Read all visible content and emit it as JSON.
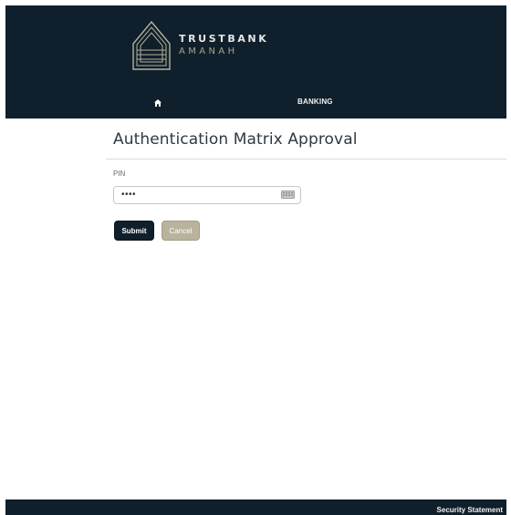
{
  "header": {
    "brand": {
      "line1": "TRUSTBANK",
      "line2": "AMANAH",
      "logo_icon": "pyramid-logo-icon"
    },
    "nav": {
      "home_icon": "home-icon",
      "banking_label": "BANKING"
    }
  },
  "main": {
    "title": "Authentication Matrix Approval",
    "pin": {
      "label": "PIN",
      "value_masked": "••••",
      "keyboard_icon": "keyboard-icon"
    },
    "buttons": {
      "submit_label": "Submit",
      "cancel_label": "Cancel"
    }
  },
  "footer": {
    "security_statement_label": "Security Statement"
  },
  "colors": {
    "navy": "#0f1f2b",
    "gold": "#a8a28c",
    "cancel_bg": "#b9b29d"
  }
}
